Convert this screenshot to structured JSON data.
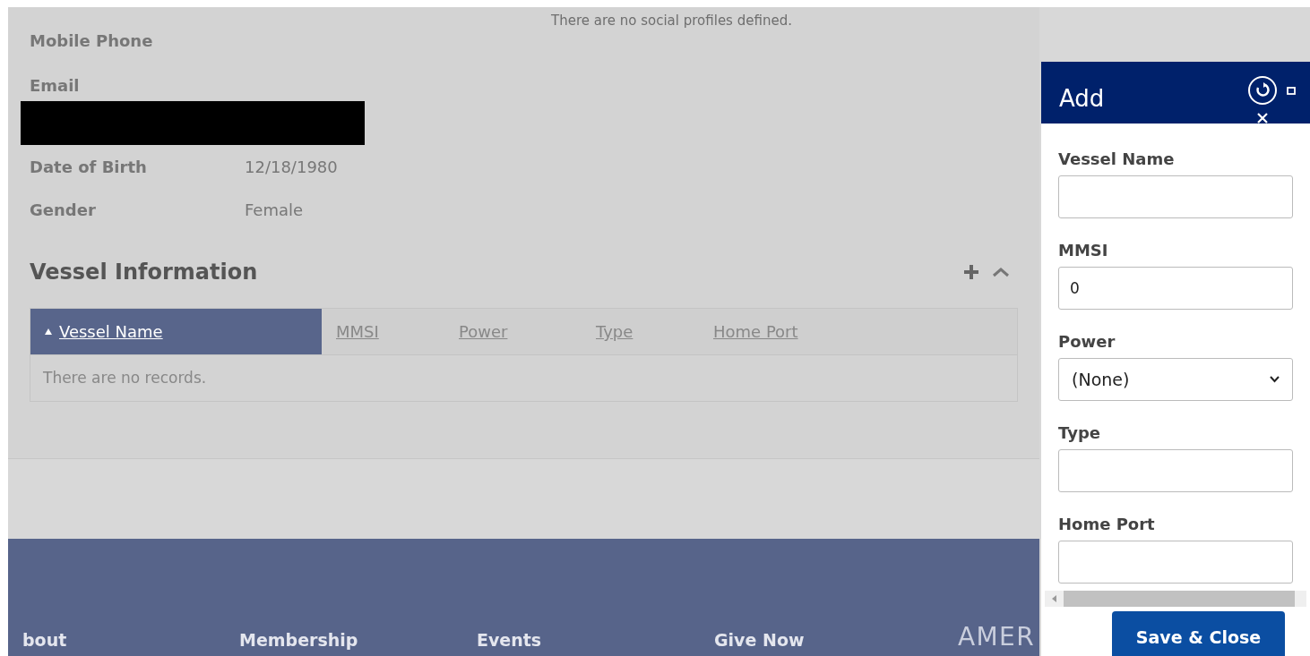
{
  "contact": {
    "fields": [
      {
        "label": "Mobile Phone",
        "kind": "plain"
      },
      {
        "label": "Email",
        "kind": "redacted"
      },
      {
        "label": "Date of Birth",
        "value": "12/18/1980",
        "kind": "plain"
      },
      {
        "label": "Gender",
        "value": "Female",
        "kind": "plain"
      }
    ],
    "social_message": "There are no social profiles defined."
  },
  "vessel_section": {
    "title": "Vessel Information",
    "expanded": true,
    "columns": [
      {
        "label": "Vessel Name",
        "selected": true,
        "sorted": true
      },
      {
        "label": "MMSI",
        "selected": false,
        "sorted": false
      },
      {
        "label": "Power",
        "selected": false,
        "sorted": false
      },
      {
        "label": "Type",
        "selected": false,
        "sorted": false
      },
      {
        "label": "Home Port",
        "selected": false,
        "sorted": false
      }
    ],
    "empty_message": "There are no records."
  },
  "footer": {
    "links": [
      "bout",
      "Membership",
      "Events",
      "Give Now"
    ],
    "logo_text": "AMER"
  },
  "dialog": {
    "title": "Add",
    "fields": [
      {
        "label": "Vessel Name",
        "kind": "text"
      },
      {
        "label": "MMSI",
        "kind": "text",
        "value": "0"
      },
      {
        "label": "Power",
        "kind": "select",
        "value": "(None)"
      },
      {
        "label": "Type",
        "kind": "text"
      },
      {
        "label": "Home Port",
        "kind": "text"
      }
    ],
    "save_button": "Save & Close"
  }
}
